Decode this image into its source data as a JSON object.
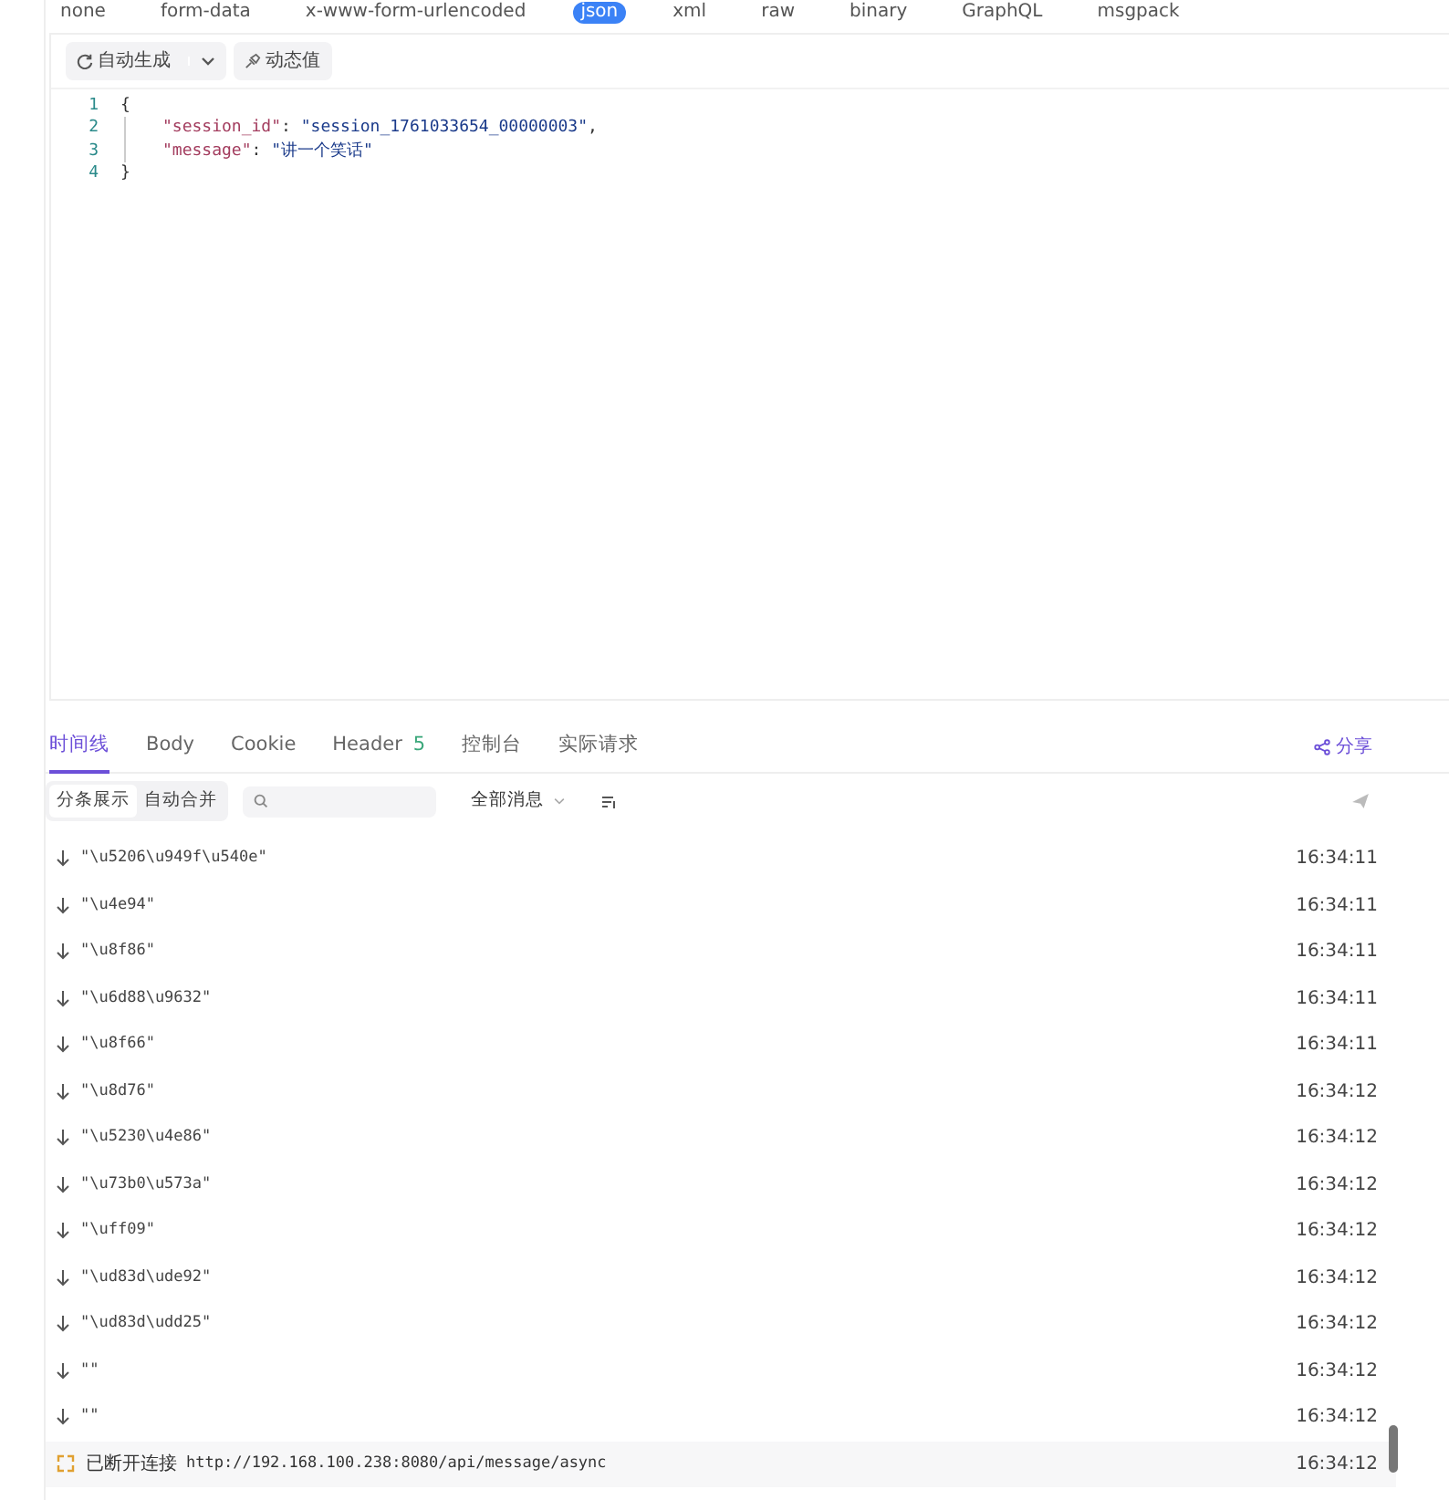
{
  "body_types": [
    {
      "label": "none",
      "selected": false
    },
    {
      "label": "form-data",
      "selected": false
    },
    {
      "label": "x-www-form-urlencoded",
      "selected": false
    },
    {
      "label": "json",
      "selected": true
    },
    {
      "label": "xml",
      "selected": false
    },
    {
      "label": "raw",
      "selected": false
    },
    {
      "label": "binary",
      "selected": false
    },
    {
      "label": "GraphQL",
      "selected": false
    },
    {
      "label": "msgpack",
      "selected": false
    }
  ],
  "editor": {
    "generate_button": "自动生成",
    "dynamic_button": "动态值",
    "lines": [
      {
        "number": "1",
        "tokens": [
          {
            "kind": "punct",
            "text": "{"
          }
        ]
      },
      {
        "number": "2",
        "tokens": [
          {
            "kind": "key",
            "text": "\"session_id\""
          },
          {
            "kind": "punct",
            "text": ": "
          },
          {
            "kind": "string",
            "text": "\"session_1761033654_00000003\""
          },
          {
            "kind": "punct",
            "text": ","
          }
        ]
      },
      {
        "number": "3",
        "tokens": [
          {
            "kind": "key",
            "text": "\"message\""
          },
          {
            "kind": "punct",
            "text": ": "
          },
          {
            "kind": "string",
            "text": "\"讲一个笑话\""
          }
        ]
      },
      {
        "number": "4",
        "tokens": [
          {
            "kind": "punct",
            "text": "}"
          }
        ]
      }
    ]
  },
  "response_tabs": [
    {
      "label": "时间线",
      "selected": true
    },
    {
      "label": "Body",
      "selected": false
    },
    {
      "label": "Cookie",
      "selected": false
    },
    {
      "label": "Header",
      "badge": "5",
      "selected": false
    },
    {
      "label": "控制台",
      "selected": false
    },
    {
      "label": "实际请求",
      "selected": false
    }
  ],
  "share": "分享",
  "view_modes": [
    {
      "label": "分条展示",
      "selected": true
    },
    {
      "label": "自动合并",
      "selected": false
    }
  ],
  "filter": "全部消息",
  "events": [
    {
      "kind": "received",
      "text": "\"\\u5206\\u949f\\u540e\"",
      "time": "16:34:11"
    },
    {
      "kind": "received",
      "text": "\"\\u4e94\"",
      "time": "16:34:11"
    },
    {
      "kind": "received",
      "text": "\"\\u8f86\"",
      "time": "16:34:11"
    },
    {
      "kind": "received",
      "text": "\"\\u6d88\\u9632\"",
      "time": "16:34:11"
    },
    {
      "kind": "received",
      "text": "\"\\u8f66\"",
      "time": "16:34:11"
    },
    {
      "kind": "received",
      "text": "\"\\u8d76\"",
      "time": "16:34:12"
    },
    {
      "kind": "received",
      "text": "\"\\u5230\\u4e86\"",
      "time": "16:34:12"
    },
    {
      "kind": "received",
      "text": "\"\\u73b0\\u573a\"",
      "time": "16:34:12"
    },
    {
      "kind": "received",
      "text": "\"\\uff09\"",
      "time": "16:34:12"
    },
    {
      "kind": "received",
      "text": "\"\\ud83d\\ude92\"",
      "time": "16:34:12"
    },
    {
      "kind": "received",
      "text": "\"\\ud83d\\udd25\"",
      "time": "16:34:12"
    },
    {
      "kind": "received",
      "text": "\"\"",
      "time": "16:34:12"
    },
    {
      "kind": "received",
      "text": "\"\"",
      "time": "16:34:12"
    },
    {
      "kind": "disconnected",
      "text": "已断开连接",
      "url": "http://192.168.100.238:8080/api/message/async",
      "time": "16:34:12"
    }
  ]
}
